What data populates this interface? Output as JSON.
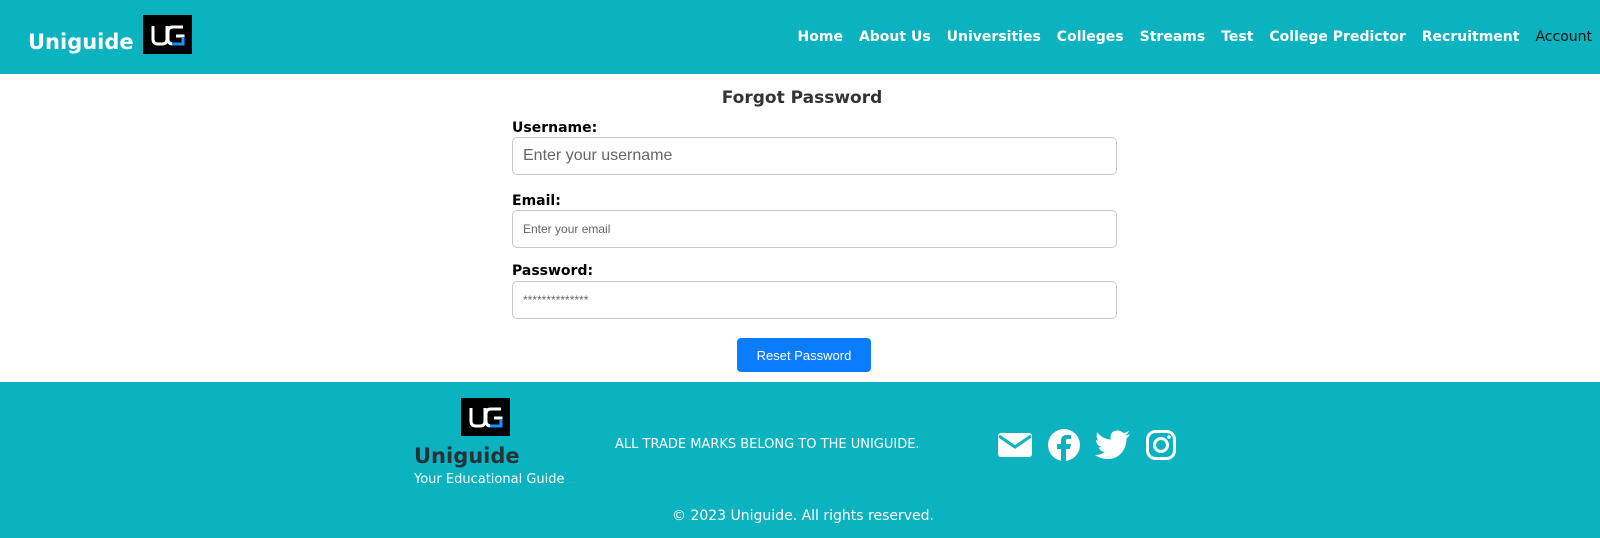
{
  "header": {
    "brand": "Uniguide",
    "nav": [
      "Home",
      "About Us",
      "Universities",
      "Colleges",
      "Streams",
      "Test",
      "College Predictor",
      "Recruitment"
    ],
    "account": "Account"
  },
  "form": {
    "title": "Forgot Password",
    "username_label": "Username:",
    "username_placeholder": "Enter your username",
    "email_label": "Email:",
    "email_placeholder": "Enter your email",
    "password_label": "Password:",
    "password_placeholder": "**************",
    "submit_label": "Reset Password"
  },
  "footer": {
    "brand": "Uniguide",
    "tagline": "Your Educational Guide",
    "trademark": "ALL TRADE MARKS BELONG TO THE UNIGUIDE.",
    "copyright": "© 2023 Uniguide. All rights reserved.",
    "social_icons": [
      "envelope-icon",
      "facebook-icon",
      "twitter-icon",
      "instagram-icon"
    ]
  },
  "colors": {
    "bar": "#0ab3bf",
    "button": "#0a7cff",
    "logo_accent": "#1e90ff"
  }
}
